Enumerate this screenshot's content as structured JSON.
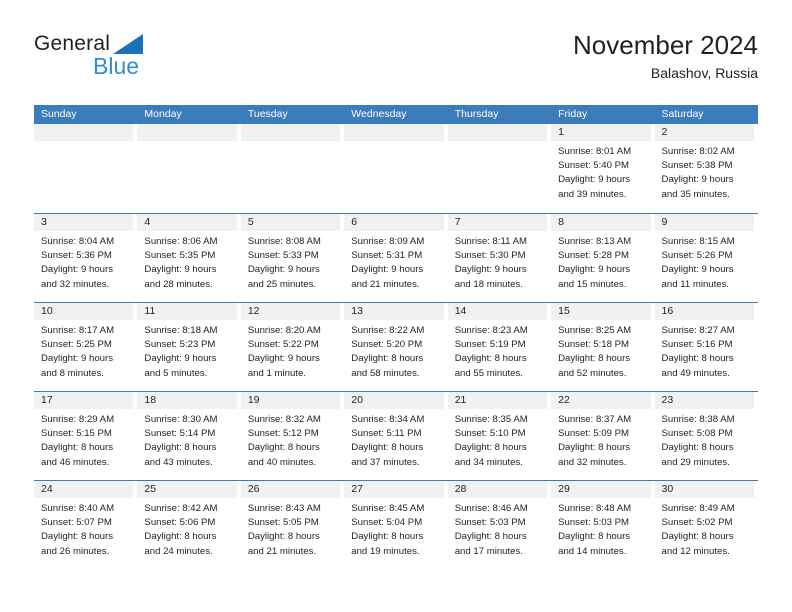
{
  "brand": {
    "name_top": "General",
    "name_bottom": "Blue",
    "triangle_color": "#1d71b8",
    "bottom_color": "#2f8fd4"
  },
  "header": {
    "title": "November 2024",
    "subtitle": "Balashov, Russia"
  },
  "colors": {
    "header_blue": "#3d7cba",
    "daynum_gray": "#f1f1f1",
    "text": "#231f20"
  },
  "weekday_headers": [
    "Sunday",
    "Monday",
    "Tuesday",
    "Wednesday",
    "Thursday",
    "Friday",
    "Saturday"
  ],
  "weeks": [
    [
      {
        "day": "",
        "sunrise": "",
        "sunset": "",
        "daylight_line1": "",
        "daylight_line2": ""
      },
      {
        "day": "",
        "sunrise": "",
        "sunset": "",
        "daylight_line1": "",
        "daylight_line2": ""
      },
      {
        "day": "",
        "sunrise": "",
        "sunset": "",
        "daylight_line1": "",
        "daylight_line2": ""
      },
      {
        "day": "",
        "sunrise": "",
        "sunset": "",
        "daylight_line1": "",
        "daylight_line2": ""
      },
      {
        "day": "",
        "sunrise": "",
        "sunset": "",
        "daylight_line1": "",
        "daylight_line2": ""
      },
      {
        "day": "1",
        "sunrise": "Sunrise: 8:01 AM",
        "sunset": "Sunset: 5:40 PM",
        "daylight_line1": "Daylight: 9 hours",
        "daylight_line2": "and 39 minutes."
      },
      {
        "day": "2",
        "sunrise": "Sunrise: 8:02 AM",
        "sunset": "Sunset: 5:38 PM",
        "daylight_line1": "Daylight: 9 hours",
        "daylight_line2": "and 35 minutes."
      }
    ],
    [
      {
        "day": "3",
        "sunrise": "Sunrise: 8:04 AM",
        "sunset": "Sunset: 5:36 PM",
        "daylight_line1": "Daylight: 9 hours",
        "daylight_line2": "and 32 minutes."
      },
      {
        "day": "4",
        "sunrise": "Sunrise: 8:06 AM",
        "sunset": "Sunset: 5:35 PM",
        "daylight_line1": "Daylight: 9 hours",
        "daylight_line2": "and 28 minutes."
      },
      {
        "day": "5",
        "sunrise": "Sunrise: 8:08 AM",
        "sunset": "Sunset: 5:33 PM",
        "daylight_line1": "Daylight: 9 hours",
        "daylight_line2": "and 25 minutes."
      },
      {
        "day": "6",
        "sunrise": "Sunrise: 8:09 AM",
        "sunset": "Sunset: 5:31 PM",
        "daylight_line1": "Daylight: 9 hours",
        "daylight_line2": "and 21 minutes."
      },
      {
        "day": "7",
        "sunrise": "Sunrise: 8:11 AM",
        "sunset": "Sunset: 5:30 PM",
        "daylight_line1": "Daylight: 9 hours",
        "daylight_line2": "and 18 minutes."
      },
      {
        "day": "8",
        "sunrise": "Sunrise: 8:13 AM",
        "sunset": "Sunset: 5:28 PM",
        "daylight_line1": "Daylight: 9 hours",
        "daylight_line2": "and 15 minutes."
      },
      {
        "day": "9",
        "sunrise": "Sunrise: 8:15 AM",
        "sunset": "Sunset: 5:26 PM",
        "daylight_line1": "Daylight: 9 hours",
        "daylight_line2": "and 11 minutes."
      }
    ],
    [
      {
        "day": "10",
        "sunrise": "Sunrise: 8:17 AM",
        "sunset": "Sunset: 5:25 PM",
        "daylight_line1": "Daylight: 9 hours",
        "daylight_line2": "and 8 minutes."
      },
      {
        "day": "11",
        "sunrise": "Sunrise: 8:18 AM",
        "sunset": "Sunset: 5:23 PM",
        "daylight_line1": "Daylight: 9 hours",
        "daylight_line2": "and 5 minutes."
      },
      {
        "day": "12",
        "sunrise": "Sunrise: 8:20 AM",
        "sunset": "Sunset: 5:22 PM",
        "daylight_line1": "Daylight: 9 hours",
        "daylight_line2": "and 1 minute."
      },
      {
        "day": "13",
        "sunrise": "Sunrise: 8:22 AM",
        "sunset": "Sunset: 5:20 PM",
        "daylight_line1": "Daylight: 8 hours",
        "daylight_line2": "and 58 minutes."
      },
      {
        "day": "14",
        "sunrise": "Sunrise: 8:23 AM",
        "sunset": "Sunset: 5:19 PM",
        "daylight_line1": "Daylight: 8 hours",
        "daylight_line2": "and 55 minutes."
      },
      {
        "day": "15",
        "sunrise": "Sunrise: 8:25 AM",
        "sunset": "Sunset: 5:18 PM",
        "daylight_line1": "Daylight: 8 hours",
        "daylight_line2": "and 52 minutes."
      },
      {
        "day": "16",
        "sunrise": "Sunrise: 8:27 AM",
        "sunset": "Sunset: 5:16 PM",
        "daylight_line1": "Daylight: 8 hours",
        "daylight_line2": "and 49 minutes."
      }
    ],
    [
      {
        "day": "17",
        "sunrise": "Sunrise: 8:29 AM",
        "sunset": "Sunset: 5:15 PM",
        "daylight_line1": "Daylight: 8 hours",
        "daylight_line2": "and 46 minutes."
      },
      {
        "day": "18",
        "sunrise": "Sunrise: 8:30 AM",
        "sunset": "Sunset: 5:14 PM",
        "daylight_line1": "Daylight: 8 hours",
        "daylight_line2": "and 43 minutes."
      },
      {
        "day": "19",
        "sunrise": "Sunrise: 8:32 AM",
        "sunset": "Sunset: 5:12 PM",
        "daylight_line1": "Daylight: 8 hours",
        "daylight_line2": "and 40 minutes."
      },
      {
        "day": "20",
        "sunrise": "Sunrise: 8:34 AM",
        "sunset": "Sunset: 5:11 PM",
        "daylight_line1": "Daylight: 8 hours",
        "daylight_line2": "and 37 minutes."
      },
      {
        "day": "21",
        "sunrise": "Sunrise: 8:35 AM",
        "sunset": "Sunset: 5:10 PM",
        "daylight_line1": "Daylight: 8 hours",
        "daylight_line2": "and 34 minutes."
      },
      {
        "day": "22",
        "sunrise": "Sunrise: 8:37 AM",
        "sunset": "Sunset: 5:09 PM",
        "daylight_line1": "Daylight: 8 hours",
        "daylight_line2": "and 32 minutes."
      },
      {
        "day": "23",
        "sunrise": "Sunrise: 8:38 AM",
        "sunset": "Sunset: 5:08 PM",
        "daylight_line1": "Daylight: 8 hours",
        "daylight_line2": "and 29 minutes."
      }
    ],
    [
      {
        "day": "24",
        "sunrise": "Sunrise: 8:40 AM",
        "sunset": "Sunset: 5:07 PM",
        "daylight_line1": "Daylight: 8 hours",
        "daylight_line2": "and 26 minutes."
      },
      {
        "day": "25",
        "sunrise": "Sunrise: 8:42 AM",
        "sunset": "Sunset: 5:06 PM",
        "daylight_line1": "Daylight: 8 hours",
        "daylight_line2": "and 24 minutes."
      },
      {
        "day": "26",
        "sunrise": "Sunrise: 8:43 AM",
        "sunset": "Sunset: 5:05 PM",
        "daylight_line1": "Daylight: 8 hours",
        "daylight_line2": "and 21 minutes."
      },
      {
        "day": "27",
        "sunrise": "Sunrise: 8:45 AM",
        "sunset": "Sunset: 5:04 PM",
        "daylight_line1": "Daylight: 8 hours",
        "daylight_line2": "and 19 minutes."
      },
      {
        "day": "28",
        "sunrise": "Sunrise: 8:46 AM",
        "sunset": "Sunset: 5:03 PM",
        "daylight_line1": "Daylight: 8 hours",
        "daylight_line2": "and 17 minutes."
      },
      {
        "day": "29",
        "sunrise": "Sunrise: 8:48 AM",
        "sunset": "Sunset: 5:03 PM",
        "daylight_line1": "Daylight: 8 hours",
        "daylight_line2": "and 14 minutes."
      },
      {
        "day": "30",
        "sunrise": "Sunrise: 8:49 AM",
        "sunset": "Sunset: 5:02 PM",
        "daylight_line1": "Daylight: 8 hours",
        "daylight_line2": "and 12 minutes."
      }
    ]
  ]
}
